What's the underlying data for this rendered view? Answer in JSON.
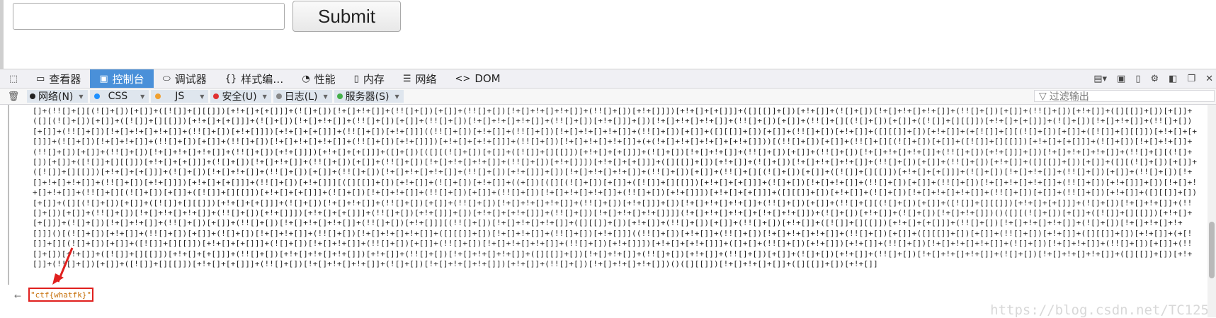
{
  "form": {
    "input_value": "",
    "submit_label": "Submit"
  },
  "toolbar": {
    "pick_icon": "element-picker-icon",
    "tabs": [
      {
        "label": "查看器",
        "icon": "inspector-icon"
      },
      {
        "label": "控制台",
        "icon": "console-icon"
      },
      {
        "label": "调试器",
        "icon": "debugger-icon"
      },
      {
        "label": "样式编…",
        "icon": "style-editor-icon"
      },
      {
        "label": "性能",
        "icon": "performance-icon"
      },
      {
        "label": "内存",
        "icon": "memory-icon"
      },
      {
        "label": "网络",
        "icon": "network-icon"
      },
      {
        "label": "DOM",
        "icon": "dom-icon"
      }
    ],
    "active_tab": "控制台"
  },
  "filters": {
    "items": [
      {
        "label": "网络(N)",
        "color": "#222222"
      },
      {
        "label": "CSS",
        "color": "#1e90ff"
      },
      {
        "label": "JS",
        "color": "#f0a030"
      },
      {
        "label": "安全(U)",
        "color": "#e03030"
      },
      {
        "label": "日志(L)",
        "color": "#888888"
      },
      {
        "label": "服务器(S)",
        "color": "#45b04a"
      }
    ],
    "filter_output_placeholder": "过滤输出"
  },
  "console": {
    "input_code": "[]+(!![]+[][(![]+[])[+[]]+([![]]+[][[]])[+!+[]+[+[]]]+(![]+[])[!+[]+!+[]]+(!![]+[])[+[]]+(!![]+[])[!+[]+!+[]+!+[]]+(!![]+[])[+!+[]]])[+!+[]+[+[]]]+([][[]]+[])[+!+[]]+(![]+[])[!+[]+!+[]+!+[]]+(!![]+[])[+[]]+(!![]+[])[+!+[]]+([][[]]+[])[+[]]+([][(![]+[])[+[]]+([![]]+[][[]])[+!+[]+[+[]]]+(![]+[])[!+[]+!+[]]+(!![]+[])[+[]]+(!![]+[])[!+[]+!+[]+!+[]]+(!![]+[])[+!+[]]]+[])[!+[]+!+[]+!+[]]+(!![]+[])[+[]]+(!![]+[][(![]+[])[+[]]+([![]]+[][[]])[+!+[]+[+[]]]+(![]+[])[!+[]+!+[]]+(!![]+[])[+[]]+(!![]+[])[!+[]+!+[]+!+[]]+(!![]+[])[+!+[]]])[+!+[]+[+[]]]+(!![]+[])[+!+[]]]((!![]+[])[+!+[]]+(!![]+[])[!+[]+!+[]+!+[]]+(!![]+[])[+[]]+([][[]]+[])[+[]]+(!![]+[])[+!+[]]+([][[]]+[])[+!+[]]+(+[![]]+[][(![]+[])[+[]]+([![]]+[][[]])[+!+[]+[+[]]]+(![]+[])[!+[]+!+[]]+(!![]+[])[+[]]+(!![]+[])[!+[]+!+[]+!+[]]+(!![]+[])[+!+[]]])[+!+[]+[+!+[]]]+(!![]+[])[!+[]+!+[]+!+[]]+(+(!+[]+!+[]+!+[]+[+!+[]]))[(!![]+[])[+[]]+(!![]+[][(![]+[])[+[]]+([![]]+[][[]])[+!+[]+[+[]]]+(![]+[])[!+[]+!+[]]+(!![]+[])[+[]]+(!![]+[])[!+[]+!+[]+!+[]]+(!![]+[])[+!+[]]])[+!+[]+[+[]]]+([]+[])[([][(![]+[])[+[]]+([![]]+[][[]])[+!+[]+[+[]]]+(![]+[])[!+[]+!+[]]+(!![]+[])[+[]]+(!![]+[])[!+[]+!+[]+!+[]]+(!![]+[])[+!+[]]]+[])[!+[]+!+[]+!+[]]+(!![]+[][(![]+[])[+[]]+([![]]+[][[]])[+!+[]+[+[]]]+(![]+[])[!+[]+!+[]]+(!![]+[])[+[]]+(!![]+[])[!+[]+!+[]+!+[]]+(!![]+[])[+!+[]]])[+!+[]+[+[]]]+([][[]]+[])[+!+[]]+(![]+[])[!+[]+!+[]+!+[]]+(!![]+[])[+[]]+(!![]+[])[+!+[]]+([][[]]+[])[+[]]+([][(![]+[])[+[]]+([![]]+[][[]])[+!+[]+[+[]]]+(![]+[])[!+[]+!+[]]+(!![]+[])[+[]]+(!![]+[])[!+[]+!+[]+!+[]]+(!![]+[])[+!+[]]]+[])[!+[]+!+[]+!+[]]+(!![]+[])[+[]]+(!![]+[][(![]+[])[+[]]+([![]]+[][[]])[+!+[]+[+[]]]+(![]+[])[!+[]+!+[]]+(!![]+[])[+[]]+(!![]+[])[!+[]+!+[]+!+[]]+(!![]+[])[+!+[]]])[+!+[]+[+[]]]+(!![]+[])[+!+[]]][([][[]]+[])[+!+[]]+(![]+[])[+!+[]]+((+[])[([][(![]+[])[+[]]+([![]]+[][[]])[+!+[]+[+[]]]+(![]+[])[!+[]+!+[]]+(!![]+[])[+[]]+(!![]+[])[!+[]+!+[]+!+[]]+(!![]+[])[+!+[]]]+[])[!+[]+!+[]+!+[]]+(!![]+[][(![]+[])[+[]]+([![]]+[][[]])[+!+[]+[+[]]]+(![]+[])[!+[]+!+[]]+(!![]+[])[+[]]+(!![]+[])[!+[]+!+[]+!+[]]+(!![]+[])[+!+[]]])[+!+[]+[+[]]]+([][[]]+[])[+!+[]]+(![]+[])[!+[]+!+[]+!+[]]+(!![]+[])[+[]]+(!![]+[])[+!+[]]+([][[]]+[])[+[]]+([][(![]+[])[+[]]+([![]]+[][[]])[+!+[]+[+[]]]+(![]+[])[!+[]+!+[]]+(!![]+[])[+[]]+(!![]+[])[!+[]+!+[]+!+[]]+(!![]+[])[+!+[]]]+[])[!+[]+!+[]+!+[]]+(!![]+[])[+[]]+(!![]+[][(![]+[])[+[]]+([![]]+[][[]])[+!+[]+[+[]]]+(![]+[])[!+[]+!+[]]+(!![]+[])[+[]]+(!![]+[])[!+[]+!+[]+!+[]]+(!![]+[])[+!+[]]])[+!+[]+[+[]]]+(!![]+[])[+!+[]]]+[])[+!+[]+[+!+[]]]+(!![]+[])[!+[]+!+[]+!+[]]]](!+[]+!+[]+!+[]+[!+[]+!+[]])+(![]+[])[+!+[]]+(![]+[])[!+[]+!+[]])()([][(![]+[])[+[]]+([![]]+[][[]])[+!+[]+[+[]]]+(![]+[])[!+[]+!+[]]+(!![]+[])[+[]]+(!![]+[])[!+[]+!+[]+!+[]]+(!![]+[])[+!+[]]][(!![]+[])[!+[]+!+[]+!+[]]+([][[]]+[])[+!+[]]+(!![]+[])[+[]]+(!![]+[])[+!+[]]+([![]]+[][[]])[+!+[]+[+[]]]+(!![]+[])[!+[]+!+[]+!+[]]+(![]+[])[!+[]+!+[]+!+[]]]()[(![]+[])[+!+[]]+(!![]+[])[+[]]+(![]+[])[!+[]+!+[]]+(!![]+[])[!+[]+!+[]+!+[]]+([][[]]+[])[!+[]+!+[]]+(!![]+[])[+!+[]]]((!![]+[])[+!+[]]+(!![]+[])[!+[]+!+[]+!+[]]+(!![]+[])[+[]]+([][[]]+[])[+[]]+(!![]+[])[+!+[]]+([][[]]+[])[+!+[]]+(+[![]]+[][(![]+[])[+[]]+([![]]+[][[]])[+!+[]+[+[]]]+(![]+[])[!+[]+!+[]]+(!![]+[])[+[]]+(!![]+[])[!+[]+!+[]+!+[]]+(!![]+[])[+!+[]]])[+!+[]+[+!+[]]]+([]+[]+(!![]+[])[+!+[]])[+!+[]]+(!![]+[])[!+[]+!+[]+!+[]]+(![]+[])[!+[]+!+[]]+(!![]+[])[+[]]+(!![]+[])[+!+[]]+([![]]+[][[]])[+!+[]+[+[]]]+(!![]+[])[+!+[]+!+[]+!+[]])[+!+[]]+(!![]+[])[!+[]+!+[]+!+[]]+([][[]]+[])[!+[]+!+[]]+(!![]+[])[+!+[]]+(!![]+[])[+[]]+(![]+[])[+!+[]]+(!![]+[])[!+[]+!+[]+!+[]]+(![]+[])[!+[]+!+[]+!+[]]+([][[]]+[])[+!+[]]+(!![]+[])[+[]]+([![]]+[][[]])[+!+[]+[+[]]]+(!![]+[])[!+[]+!+[]+!+[]]+(![]+[])[!+[]+!+[]+!+[]])[+!+[]]+(!![]+[])[!+[]+!+[]+!+[]])()([][[]])[!+[]+!+[]+[]]+([][[]]+[])[+!+[]]",
    "result": "\"ctf{whatfk}\"",
    "watermark": "https://blog.csdn.net/TC125"
  }
}
